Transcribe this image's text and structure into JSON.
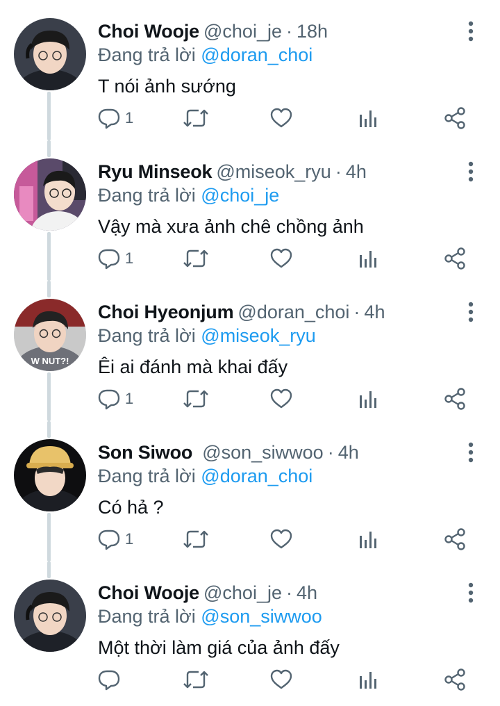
{
  "tweets": [
    {
      "name": "Choi Wooje",
      "handle": "@choi_je",
      "time": "18h",
      "replying_prefix": "Đang trả lời",
      "replying_to": "@doran_choi",
      "text": "T nói ảnh sướng",
      "reply_count": "1",
      "avatar_icon": "avatar-photo"
    },
    {
      "name": "Ryu Minseok",
      "handle": "@miseok_ryu",
      "time": "4h",
      "replying_prefix": "Đang trả lời",
      "replying_to": "@choi_je",
      "text": "Vậy mà xưa ảnh chê chồng ảnh",
      "reply_count": "1",
      "avatar_icon": "avatar-photo"
    },
    {
      "name": "Choi Hyeonjum",
      "handle": "@doran_choi",
      "time": "4h",
      "replying_prefix": "Đang trả lời",
      "replying_to": "@miseok_ryu",
      "text": "Êi ai đánh mà khai đấy",
      "reply_count": "1",
      "avatar_icon": "avatar-photo"
    },
    {
      "name": "Son Siwoo",
      "handle": "@son_siwwoo",
      "time": "4h",
      "replying_prefix": "Đang trả lời",
      "replying_to": "@doran_choi",
      "text": "Có hả ?",
      "reply_count": "1",
      "avatar_icon": "avatar-photo"
    },
    {
      "name": "Choi Wooje",
      "handle": "@choi_je",
      "time": "4h",
      "replying_prefix": "Đang trả lời",
      "replying_to": "@son_siwwoo",
      "text": "Một thời làm giá của ảnh đấy",
      "reply_count": "",
      "avatar_icon": "avatar-photo"
    }
  ],
  "separator": "·",
  "icons": {
    "reply": "reply-icon",
    "retweet": "retweet-icon",
    "like": "heart-icon",
    "views": "views-icon",
    "share": "share-icon",
    "more": "more-vertical-icon"
  },
  "colors": {
    "text": "#0f1419",
    "secondary": "#536471",
    "link": "#1d9bf0",
    "thread_line": "#cfd9de"
  }
}
